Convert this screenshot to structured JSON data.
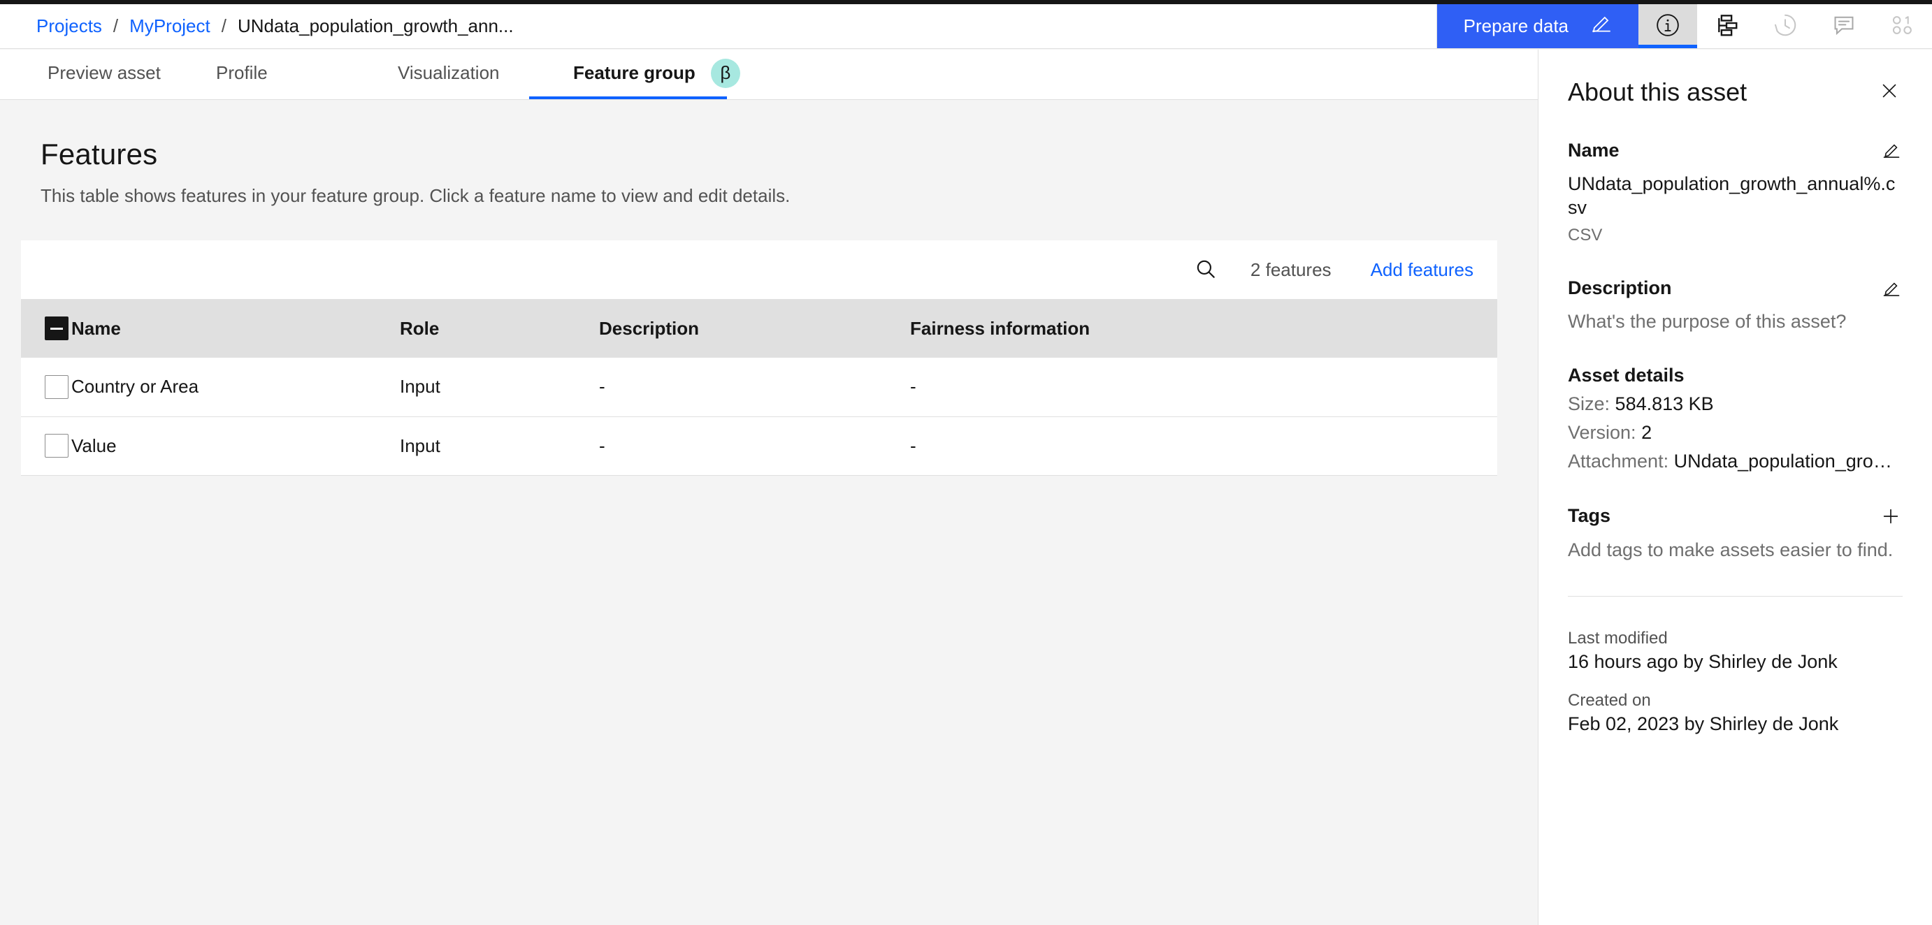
{
  "header": {
    "breadcrumb": {
      "items": [
        {
          "label": "Projects",
          "link": true
        },
        {
          "label": "MyProject",
          "link": true
        },
        {
          "label": "UNdata_population_growth_ann...",
          "link": false
        }
      ],
      "separator": "/"
    },
    "prepare_button": {
      "label": "Prepare data",
      "icon": "pencil-icon",
      "color": "#2f5ff5"
    },
    "icons": [
      {
        "name": "info-icon",
        "active": true,
        "dimmed": false
      },
      {
        "name": "lineage-icon",
        "active": false,
        "dimmed": false
      },
      {
        "name": "history-icon",
        "active": false,
        "dimmed": true
      },
      {
        "name": "comment-icon",
        "active": false,
        "dimmed": true
      },
      {
        "name": "binary-data-icon",
        "active": false,
        "dimmed": true
      }
    ]
  },
  "tabs": [
    {
      "label": "Preview asset",
      "active": false
    },
    {
      "label": "Profile",
      "active": false
    },
    {
      "label": "Visualization",
      "active": false
    },
    {
      "label": "Feature group",
      "active": true,
      "badge": "β",
      "badge_color": "#a7e8e0"
    }
  ],
  "main": {
    "title": "Features",
    "subtitle": "This table shows features in your feature group. Click a feature name to view and edit details.",
    "toolbar": {
      "search_icon": "search-icon",
      "count_label": "2 features",
      "add_link": "Add features"
    },
    "table": {
      "columns": [
        "Name",
        "Role",
        "Description",
        "Fairness information"
      ],
      "rows": [
        {
          "name": "Country or Area",
          "role": "Input",
          "description": "-",
          "fairness": "-"
        },
        {
          "name": "Value",
          "role": "Input",
          "description": "-",
          "fairness": "-"
        }
      ]
    }
  },
  "panel": {
    "title": "About this asset",
    "close_icon": "close-icon",
    "name_section": {
      "heading": "Name",
      "edit_icon": "pencil-icon",
      "value": "UNdata_population_growth_annual%.csv",
      "format": "CSV"
    },
    "description_section": {
      "heading": "Description",
      "edit_icon": "pencil-icon",
      "placeholder": "What's the purpose of this asset?"
    },
    "asset_details": {
      "heading": "Asset details",
      "size_label": "Size:",
      "size_value": "584.813 KB",
      "version_label": "Version:",
      "version_value": "2",
      "attachment_label": "Attachment:",
      "attachment_value": "UNdata_population_growth_..."
    },
    "tags_section": {
      "heading": "Tags",
      "add_icon": "plus-icon",
      "placeholder": "Add tags to make assets easier to find."
    },
    "footer": {
      "last_modified_label": "Last modified",
      "last_modified_value": "16 hours ago by Shirley de Jonk",
      "created_label": "Created on",
      "created_value": "Feb 02, 2023 by Shirley de Jonk"
    }
  }
}
